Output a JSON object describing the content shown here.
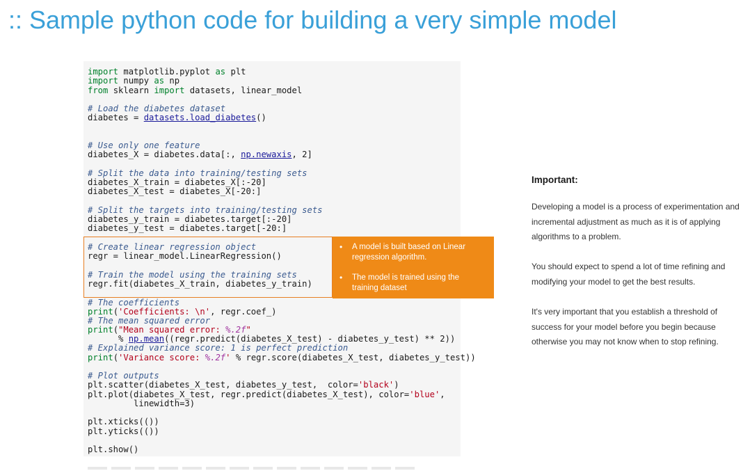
{
  "title": ":: Sample python code for building a very simple model",
  "code": {
    "l1_kw1": "import",
    "l1_rest": " matplotlib.pyplot ",
    "l1_kw2": "as",
    "l1_end": " plt",
    "l2_kw1": "import",
    "l2_rest": " numpy ",
    "l2_kw2": "as",
    "l2_end": " np",
    "l3_kw1": "from",
    "l3_rest": " sklearn ",
    "l3_kw2": "import",
    "l3_end": " datasets, linear_model",
    "c1": "# Load the diabetes dataset",
    "l5_pre": "diabetes = ",
    "l5_fn": "datasets.load_diabetes",
    "l5_post": "()",
    "c2": "# Use only one feature",
    "l7_pre": "diabetes_X = diabetes.data[:, ",
    "l7_fn": "np.newaxis",
    "l7_post": ", 2]",
    "c3": "# Split the data into training/testing sets",
    "l9": "diabetes_X_train = diabetes_X[:-20]",
    "l10": "diabetes_X_test = diabetes_X[-20:]",
    "c4": "# Split the targets into training/testing sets",
    "l12": "diabetes_y_train = diabetes.target[:-20]",
    "l13": "diabetes_y_test = diabetes.target[-20:]",
    "c5": "# Create linear regression object",
    "l15": "regr = linear_model.LinearRegression()",
    "c6": "# Train the model using the training sets",
    "l17": "regr.fit(diabetes_X_train, diabetes_y_train)",
    "c7": "# The coefficients",
    "l19_kw": "print",
    "l19_a": "(",
    "l19_st": "'Coefficients: \\n'",
    "l19_b": ", regr.coef_)",
    "c8": "# The mean squared error",
    "l21_kw": "print",
    "l21_a": "(",
    "l21_st1": "\"Mean squared error: ",
    "l21_fmt": "%.2f",
    "l21_st2": "\"",
    "l22_pre": "      % ",
    "l22_fn": "np.mean",
    "l22_post": "((regr.predict(diabetes_X_test) - diabetes_y_test) ** 2))",
    "c9": "# Explained variance score: 1 is perfect prediction",
    "l24_kw": "print",
    "l24_a": "(",
    "l24_st1": "'Variance score: ",
    "l24_fmt": "%.2f",
    "l24_st2": "'",
    "l24_b": " % regr.score(diabetes_X_test, diabetes_y_test))",
    "c10": "# Plot outputs",
    "l26_a": "plt.scatter(diabetes_X_test, diabetes_y_test,  color=",
    "l26_st": "'black'",
    "l26_b": ")",
    "l27_a": "plt.plot(diabetes_X_test, regr.predict(diabetes_X_test), color=",
    "l27_st": "'blue'",
    "l27_b": ",",
    "l28": "         linewidth=3)",
    "l29": "plt.xticks(())",
    "l30": "plt.yticks(())",
    "l31": "plt.show()"
  },
  "callout": {
    "bullet": "•",
    "item1": "A model is built based on Linear regression algorithm.",
    "item2": "The model is trained using the training dataset"
  },
  "important": {
    "heading": "Important:",
    "para1": "Developing a model is a process of experimentation and incremental adjustment as much as it is of applying algorithms to a problem.",
    "para2": "You should expect to spend a lot of time refining and modifying your model to get the best results.",
    "para3": "It's very important that you establish a threshold of success for your model before you begin because otherwise you may not know when to stop refining."
  },
  "colors": {
    "title": "#3aa0d8",
    "callout_bg": "#ef8a17",
    "highlight_border": "#e67e22",
    "code_bg": "#f5f5f5",
    "keyword": "#00802b",
    "comment": "#3a5a8f",
    "string": "#b3001b"
  }
}
